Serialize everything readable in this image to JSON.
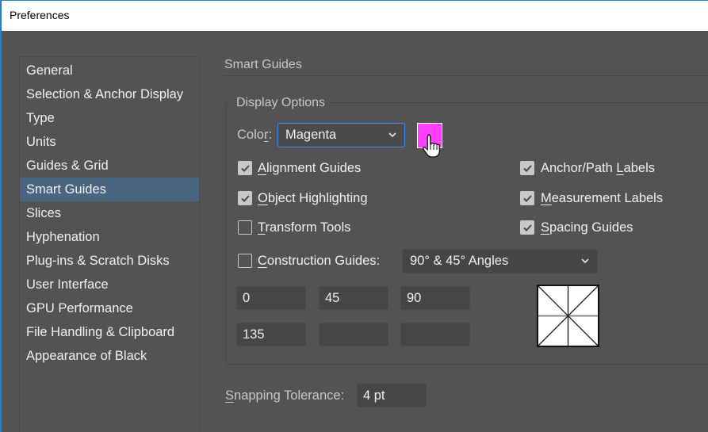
{
  "window": {
    "title": "Preferences"
  },
  "sidebar": {
    "items": [
      {
        "label": "General",
        "active": false
      },
      {
        "label": "Selection & Anchor Display",
        "active": false
      },
      {
        "label": "Type",
        "active": false
      },
      {
        "label": "Units",
        "active": false
      },
      {
        "label": "Guides & Grid",
        "active": false
      },
      {
        "label": "Smart Guides",
        "active": true
      },
      {
        "label": "Slices",
        "active": false
      },
      {
        "label": "Hyphenation",
        "active": false
      },
      {
        "label": "Plug-ins & Scratch Disks",
        "active": false
      },
      {
        "label": "User Interface",
        "active": false
      },
      {
        "label": "GPU Performance",
        "active": false
      },
      {
        "label": "File Handling & Clipboard",
        "active": false
      },
      {
        "label": "Appearance of Black",
        "active": false
      }
    ]
  },
  "main": {
    "section_title": "Smart Guides",
    "display_options": {
      "legend": "Display Options",
      "color_label_pre": "Colo",
      "color_label_ul": "r",
      "color_label_post": ":",
      "color_value": "Magenta",
      "swatch_color": "#ff40ff",
      "checkboxes_left": [
        {
          "ul": "A",
          "rest": "lignment Guides",
          "checked": true
        },
        {
          "ul": "O",
          "rest": "bject Highlighting",
          "checked": true
        },
        {
          "ul": "T",
          "rest": "ransform Tools",
          "checked": false
        }
      ],
      "checkboxes_right": [
        {
          "pre": "Anchor/Path ",
          "ul": "L",
          "rest": "abels",
          "checked": true
        },
        {
          "pre": "",
          "ul": "M",
          "rest": "easurement Labels",
          "checked": true
        },
        {
          "pre": "",
          "ul": "S",
          "rest": "pacing Guides",
          "checked": true
        }
      ],
      "construction_guides": {
        "ul": "C",
        "rest": "onstruction Guides:",
        "checked": false,
        "value": "90° & 45° Angles"
      },
      "angles": [
        "0",
        "45",
        "90",
        "135",
        "",
        ""
      ]
    },
    "snapping": {
      "ul": "S",
      "rest": "napping Tolerance:",
      "value": "4 pt"
    }
  }
}
